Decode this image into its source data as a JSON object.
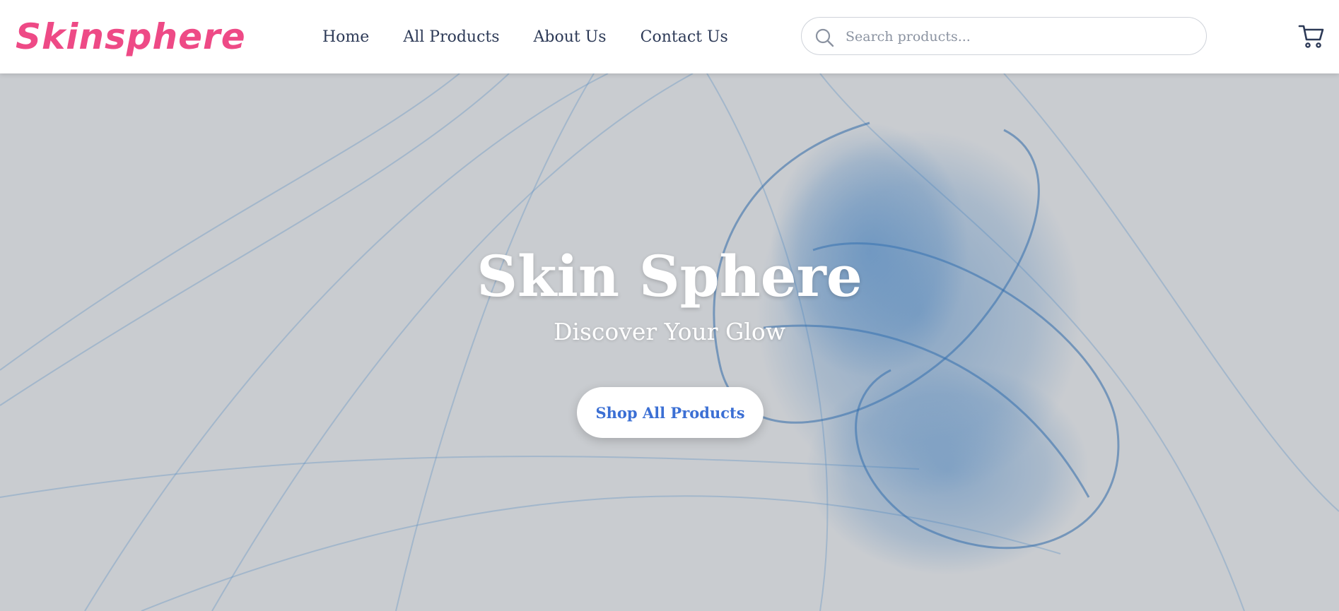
{
  "brand": {
    "logo_text": "Skinsphere",
    "color": "#ee4a86"
  },
  "nav": {
    "items": [
      {
        "label": "Home"
      },
      {
        "label": "All Products"
      },
      {
        "label": "About Us"
      },
      {
        "label": "Contact Us"
      }
    ]
  },
  "search": {
    "placeholder": "Search products...",
    "value": "",
    "icon": "search-icon"
  },
  "cart": {
    "icon": "cart-icon"
  },
  "hero": {
    "title": "Skin Sphere",
    "subtitle": "Discover Your Glow",
    "cta_label": "Shop All Products",
    "cta_color": "#3b6fd4",
    "background_color": "#c9ccd0",
    "accent_color": "#3a78b8"
  }
}
